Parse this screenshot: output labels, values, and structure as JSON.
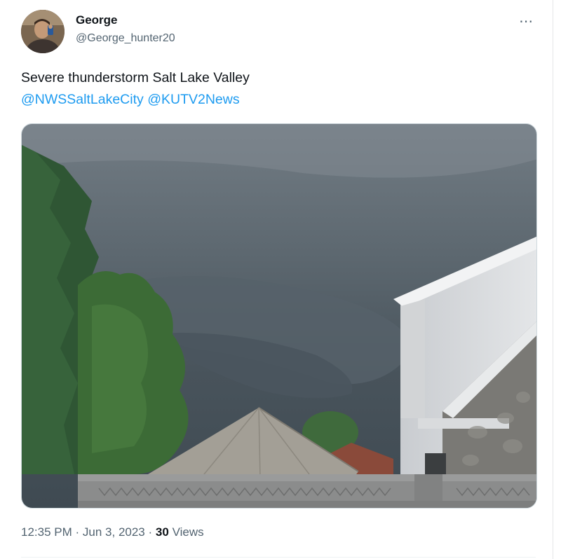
{
  "author": {
    "name": "George",
    "handle": "@George_hunter20"
  },
  "more_icon": "⋯",
  "tweet": {
    "text": "Severe thunderstorm Salt Lake Valley",
    "mentions": [
      "@NWSSaltLakeCity",
      "@KUTV2News"
    ]
  },
  "meta": {
    "time": "12:35 PM",
    "separator": "·",
    "date": "Jun 3, 2023",
    "views_count": "30",
    "views_label": "Views"
  },
  "colors": {
    "link": "#1d9bf0",
    "muted": "#536471",
    "text": "#0f1419"
  }
}
